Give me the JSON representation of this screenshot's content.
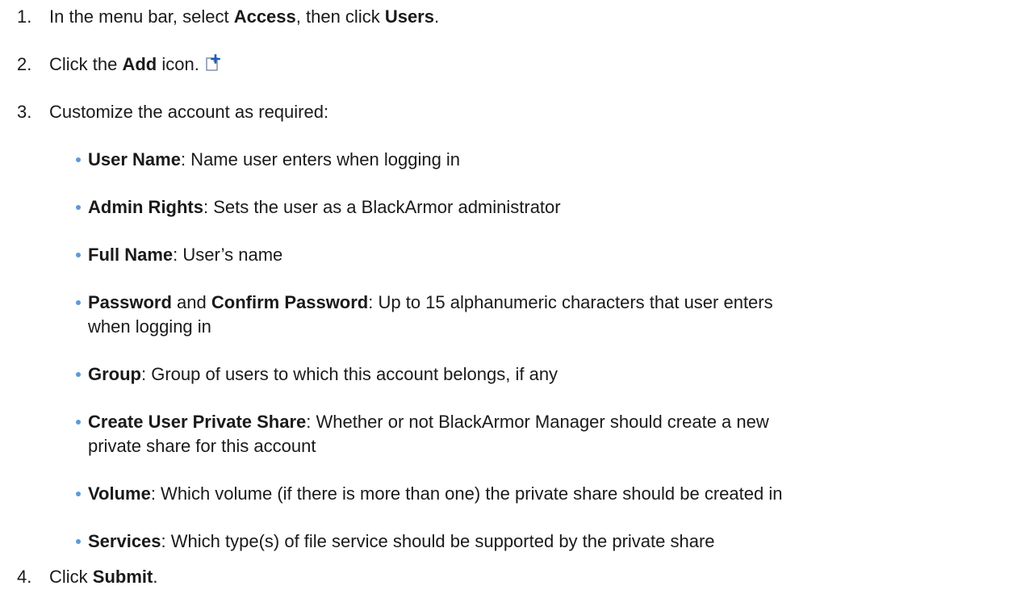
{
  "steps": [
    {
      "number": "1.",
      "pre": "In the menu bar, select ",
      "bold1": "Access",
      "mid": ", then click ",
      "bold2": "Users",
      "post": "."
    },
    {
      "number": "2.",
      "pre": "Click the ",
      "bold": "Add",
      "post": " icon.",
      "icon": "add-document-icon"
    },
    {
      "number": "3.",
      "text": "Customize the account as required:"
    },
    {
      "number": "4.",
      "pre": "Click ",
      "bold": "Submit",
      "post": "."
    }
  ],
  "bullets": [
    {
      "term": "User Name",
      "desc": ": Name user enters when logging in"
    },
    {
      "term": "Admin Rights",
      "desc": ": Sets the user as a BlackArmor administrator"
    },
    {
      "term": "Full Name",
      "desc": ": User’s name"
    },
    {
      "term": "Password",
      "mid": " and ",
      "term2": "Confirm Password",
      "desc": ": Up to 15 alphanumeric characters that user enters",
      "desc2": "when logging in"
    },
    {
      "term": "Group",
      "desc": ": Group of users to which this account belongs, if any"
    },
    {
      "term": "Create User Private Share",
      "desc": ": Whether or not BlackArmor Manager should create a new",
      "desc2": "private share for this account"
    },
    {
      "term": "Volume",
      "desc": ": Which volume (if there is more than one) the private share should be created in"
    },
    {
      "term": "Services",
      "desc": ": Which type(s) of file service should be supported by the private share"
    }
  ],
  "colors": {
    "bullet": "#5b9bd5",
    "icon_plus": "#1a5fb4",
    "text": "#1a1a1a"
  }
}
